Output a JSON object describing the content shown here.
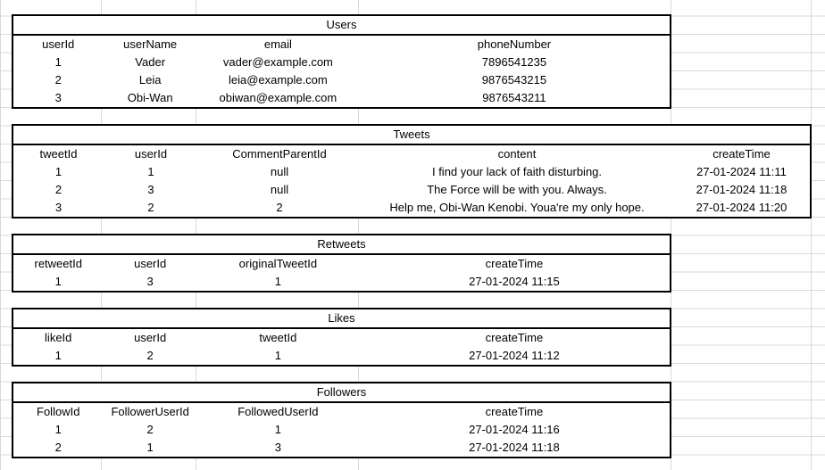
{
  "tables": {
    "users": {
      "title": "Users",
      "headers": [
        "userId",
        "userName",
        "email",
        "phoneNumber"
      ],
      "rows": [
        [
          "1",
          "Vader",
          "vader@example.com",
          "7896541235"
        ],
        [
          "2",
          "Leia",
          "leia@example.com",
          "9876543215"
        ],
        [
          "3",
          "Obi-Wan",
          "obiwan@example.com",
          "9876543211"
        ]
      ]
    },
    "tweets": {
      "title": "Tweets",
      "headers": [
        "tweetId",
        "userId",
        "CommentParentId",
        "content",
        "createTime"
      ],
      "rows": [
        [
          "1",
          "1",
          "null",
          "I find your lack of faith disturbing.",
          "27-01-2024 11:11"
        ],
        [
          "2",
          "3",
          "null",
          "The Force will be with you. Always.",
          "27-01-2024 11:18"
        ],
        [
          "3",
          "2",
          "2",
          "Help me, Obi-Wan Kenobi. Youa're my only hope.",
          "27-01-2024 11:20"
        ]
      ]
    },
    "retweets": {
      "title": "Retweets",
      "headers": [
        "retweetId",
        "userId",
        "originalTweetId",
        "createTime"
      ],
      "rows": [
        [
          "1",
          "3",
          "1",
          "27-01-2024 11:15"
        ]
      ]
    },
    "likes": {
      "title": "Likes",
      "headers": [
        "likeId",
        "userId",
        "tweetId",
        "createTime"
      ],
      "rows": [
        [
          "1",
          "2",
          "1",
          "27-01-2024 11:12"
        ]
      ]
    },
    "followers": {
      "title": "Followers",
      "headers": [
        "FollowId",
        "FollowerUserId",
        "FollowedUserId",
        "createTime"
      ],
      "rows": [
        [
          "1",
          "2",
          "1",
          "27-01-2024 11:16"
        ],
        [
          "2",
          "1",
          "3",
          "27-01-2024 11:18"
        ]
      ]
    }
  }
}
